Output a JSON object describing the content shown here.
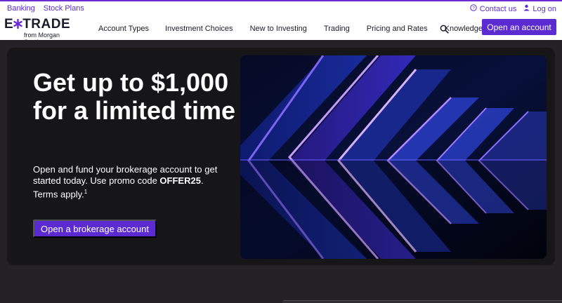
{
  "utility_nav": {
    "banking": "Banking",
    "stock_plans": "Stock Plans",
    "contact": "Contact us",
    "login": "Log on"
  },
  "brand": {
    "logo_text_left": "E",
    "logo_text_right": "TRADE",
    "logo_sub": "from Morgan Stanley",
    "accent": "#5b2bd1"
  },
  "main_nav": {
    "items": [
      {
        "label": "Account Types"
      },
      {
        "label": "Investment Choices"
      },
      {
        "label": "New to Investing"
      },
      {
        "label": "Trading"
      },
      {
        "label": "Pricing and Rates"
      },
      {
        "label": "Knowledge"
      }
    ],
    "search_icon": "search-icon",
    "open_account": "Open an account"
  },
  "hero": {
    "headline": "Get up to $1,000 for a limited time",
    "sub_prefix": "Open and fund your brokerage account to get started today. Use promo code ",
    "promo_code": "OFFER25",
    "sub_suffix": ". Terms apply.",
    "footnote": "1",
    "cta": "Open a brokerage account"
  }
}
